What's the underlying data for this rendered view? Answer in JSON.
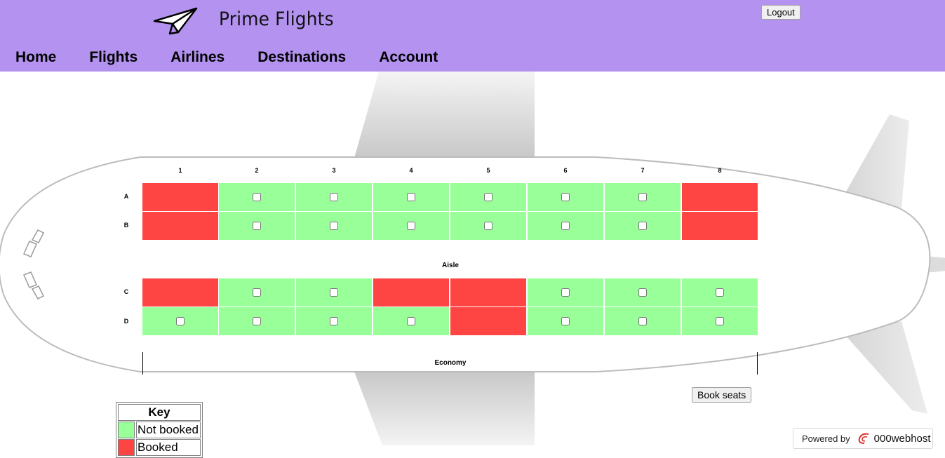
{
  "header": {
    "brand": "Prime Flights",
    "logout_label": "Logout",
    "nav": [
      "Home",
      "Flights",
      "Airlines",
      "Destinations",
      "Account"
    ]
  },
  "seatmap": {
    "columns": [
      "1",
      "2",
      "3",
      "4",
      "5",
      "6",
      "7",
      "8"
    ],
    "rows": [
      {
        "letter": "A",
        "booked": [
          true,
          false,
          false,
          false,
          false,
          false,
          false,
          true
        ]
      },
      {
        "letter": "B",
        "booked": [
          true,
          false,
          false,
          false,
          false,
          false,
          false,
          true
        ]
      },
      {
        "letter": "C",
        "booked": [
          true,
          false,
          false,
          true,
          true,
          false,
          false,
          false
        ]
      },
      {
        "letter": "D",
        "booked": [
          false,
          false,
          false,
          false,
          true,
          false,
          false,
          false
        ]
      }
    ],
    "aisle_label": "Aisle",
    "class_label": "Economy",
    "book_label": "Book seats"
  },
  "key": {
    "title": "Key",
    "items": [
      {
        "label": "Not booked",
        "color": "#99ff99"
      },
      {
        "label": "Booked",
        "color": "#ff4444"
      }
    ]
  },
  "footer": {
    "powered_by": "Powered by",
    "host": "000webhost"
  },
  "colors": {
    "header_bg": "#b392f0",
    "available": "#99ff99",
    "booked": "#ff4444"
  },
  "icons": {
    "logo": "paper-plane-icon",
    "host_logo": "000webhost-swirl-icon"
  }
}
